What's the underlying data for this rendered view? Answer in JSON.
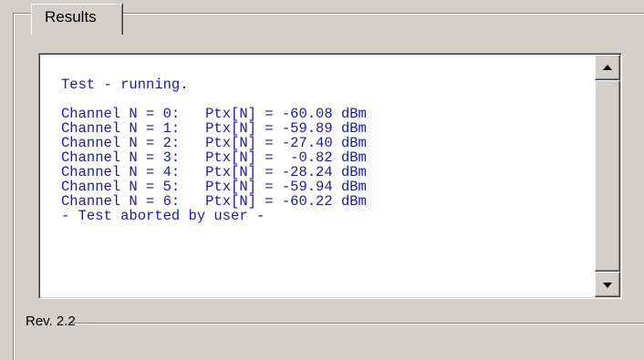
{
  "group": {
    "title": "Results"
  },
  "log": {
    "lines": [
      "Test - running.",
      "",
      "Channel N = 0:   Ptx[N] = -60.08 dBm",
      "Channel N = 1:   Ptx[N] = -59.89 dBm",
      "Channel N = 2:   Ptx[N] = -27.40 dBm",
      "Channel N = 3:   Ptx[N] =  -0.82 dBm",
      "Channel N = 4:   Ptx[N] = -28.24 dBm",
      "Channel N = 5:   Ptx[N] = -59.94 dBm",
      "Channel N = 6:   Ptx[N] = -60.22 dBm",
      "- Test aborted by user -"
    ]
  },
  "scrollbar": {
    "up_icon": "arrow-up-icon",
    "down_icon": "arrow-down-icon"
  },
  "footer": {
    "revision": "Rev. 2.2"
  },
  "colors": {
    "background": "#d4d0c8",
    "text_output": "#1a1aa6"
  }
}
